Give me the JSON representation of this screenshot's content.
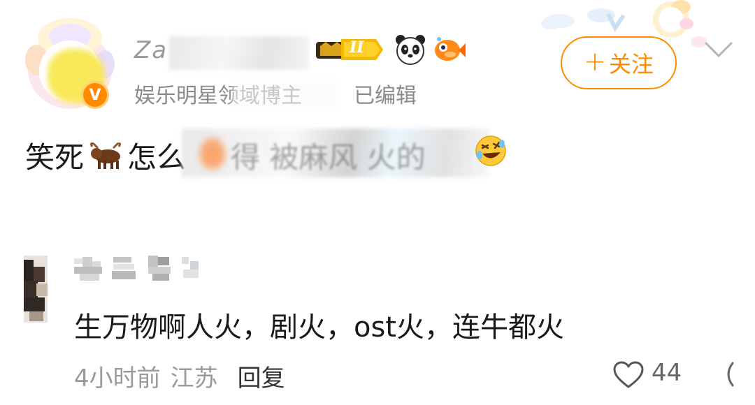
{
  "post": {
    "author": {
      "name": "Za",
      "level": "II",
      "verified_label": "娱乐明星领域博主",
      "edited_label": "已编辑"
    },
    "follow_button": {
      "plus": "+",
      "label": "关注"
    },
    "content": {
      "prefix": "笑死",
      "middle": "怎么",
      "obscured": "得 被麻风 火的"
    }
  },
  "reply": {
    "text": "生万物啊人火，剧火，ost火，连牛都火",
    "time": "4小时前",
    "location": "江苏",
    "reply_label": "回复",
    "likes": "44"
  },
  "colors": {
    "accent": "#ff8c00",
    "meta": "#9a9a9a",
    "text": "#1a1a1a"
  }
}
